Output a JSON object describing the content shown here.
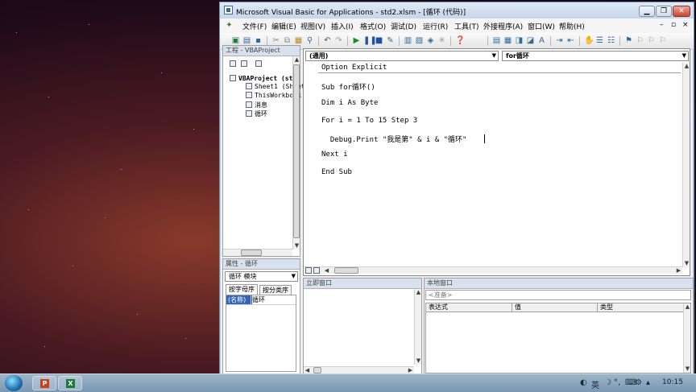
{
  "window": {
    "title": "Microsoft Visual Basic for Applications - std2.xlsm - [循环 (代码)]",
    "minimize": "▁",
    "restore": "❐",
    "close": "✕",
    "inner_minimize": "–",
    "inner_restore": "▫",
    "inner_close": "×"
  },
  "menu": [
    "文件(F)",
    "编辑(E)",
    "视图(V)",
    "插入(I)",
    "格式(O)",
    "调试(D)",
    "运行(R)",
    "工具(T)",
    "外接程序(A)",
    "窗口(W)",
    "帮助(H)"
  ],
  "project": {
    "title": "工程 - VBAProject",
    "root": "VBAProject (st",
    "items": [
      "Sheet1 (Sheet",
      "ThisWorkbook",
      "消息",
      "循环"
    ]
  },
  "properties": {
    "title": "属性 - 循环",
    "object": "循环  模块",
    "tabs": [
      "按字母序",
      "按分类序"
    ],
    "prop_name": "(名称)",
    "prop_value": "循环"
  },
  "editor": {
    "object_combo": "(通用)",
    "proc_combo": "for循环",
    "lines": [
      "Option Explicit",
      "Sub for循环()",
      "Dim i As Byte",
      "For i = 1 To 15 Step 3",
      "  Debug.Print \"我是第\" & i & \"循环\"",
      "Next i",
      "End Sub"
    ]
  },
  "immediate": {
    "title": "立即窗口"
  },
  "locals": {
    "title": "本地窗口",
    "status": "<准备>",
    "columns": [
      "表达式",
      "值",
      "类型"
    ]
  },
  "taskbar": {
    "apps": [
      "P",
      "X"
    ],
    "ime": "英",
    "clock": "10:15"
  },
  "colors": {
    "title_bar": "#c5d7ec",
    "pane_title": "#d8e2ee",
    "selection": "#3367b5"
  }
}
